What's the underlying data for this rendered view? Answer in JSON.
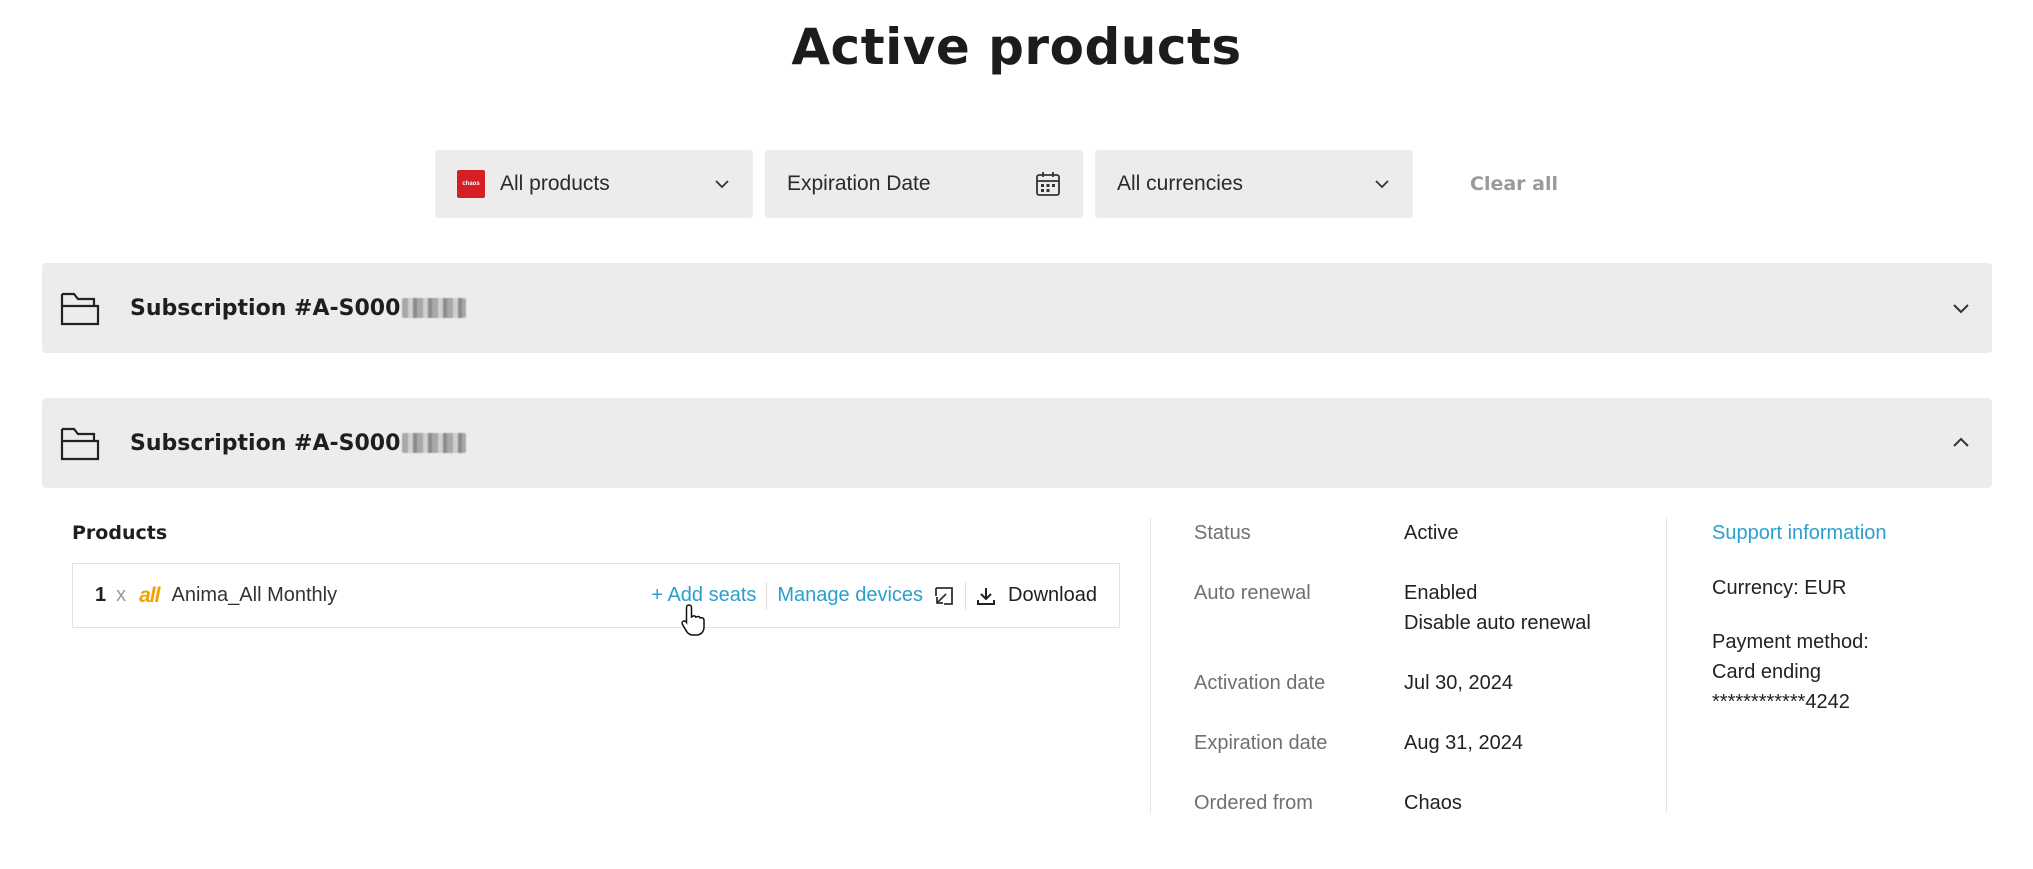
{
  "page": {
    "title": "Active products"
  },
  "filters": {
    "products": {
      "brand": "chaos",
      "label": "All products"
    },
    "expiration": {
      "label": "Expiration Date"
    },
    "currencies": {
      "label": "All currencies"
    },
    "clear_all": "Clear all"
  },
  "subscriptions": [
    {
      "title": "Subscription #A-S000",
      "expanded": false
    },
    {
      "title": "Subscription #A-S000",
      "expanded": true
    }
  ],
  "products_section": {
    "heading": "Products",
    "items": [
      {
        "quantity": "1",
        "times": "x",
        "logo": "all",
        "name": "Anima_All Monthly",
        "add_seats": "+ Add seats",
        "manage_devices": "Manage devices",
        "download": "Download"
      }
    ]
  },
  "details": {
    "status_label": "Status",
    "status_value": "Active",
    "auto_renewal_label": "Auto renewal",
    "auto_renewal_value": "Enabled",
    "disable_auto_renewal": "Disable auto renewal",
    "activation_label": "Activation date",
    "activation_value": "Jul 30, 2024",
    "expiration_label": "Expiration date",
    "expiration_value": "Aug 31, 2024",
    "ordered_label": "Ordered from",
    "ordered_value": "Chaos"
  },
  "side": {
    "support_link": "Support information",
    "currency": "Currency: EUR",
    "payment_label": "Payment method:",
    "payment_card": "Card ending",
    "payment_number": "************4242"
  },
  "colors": {
    "link": "#2b9fcc",
    "panel": "#ececec",
    "brand_red": "#d51f26",
    "anima": "#f0a400"
  }
}
